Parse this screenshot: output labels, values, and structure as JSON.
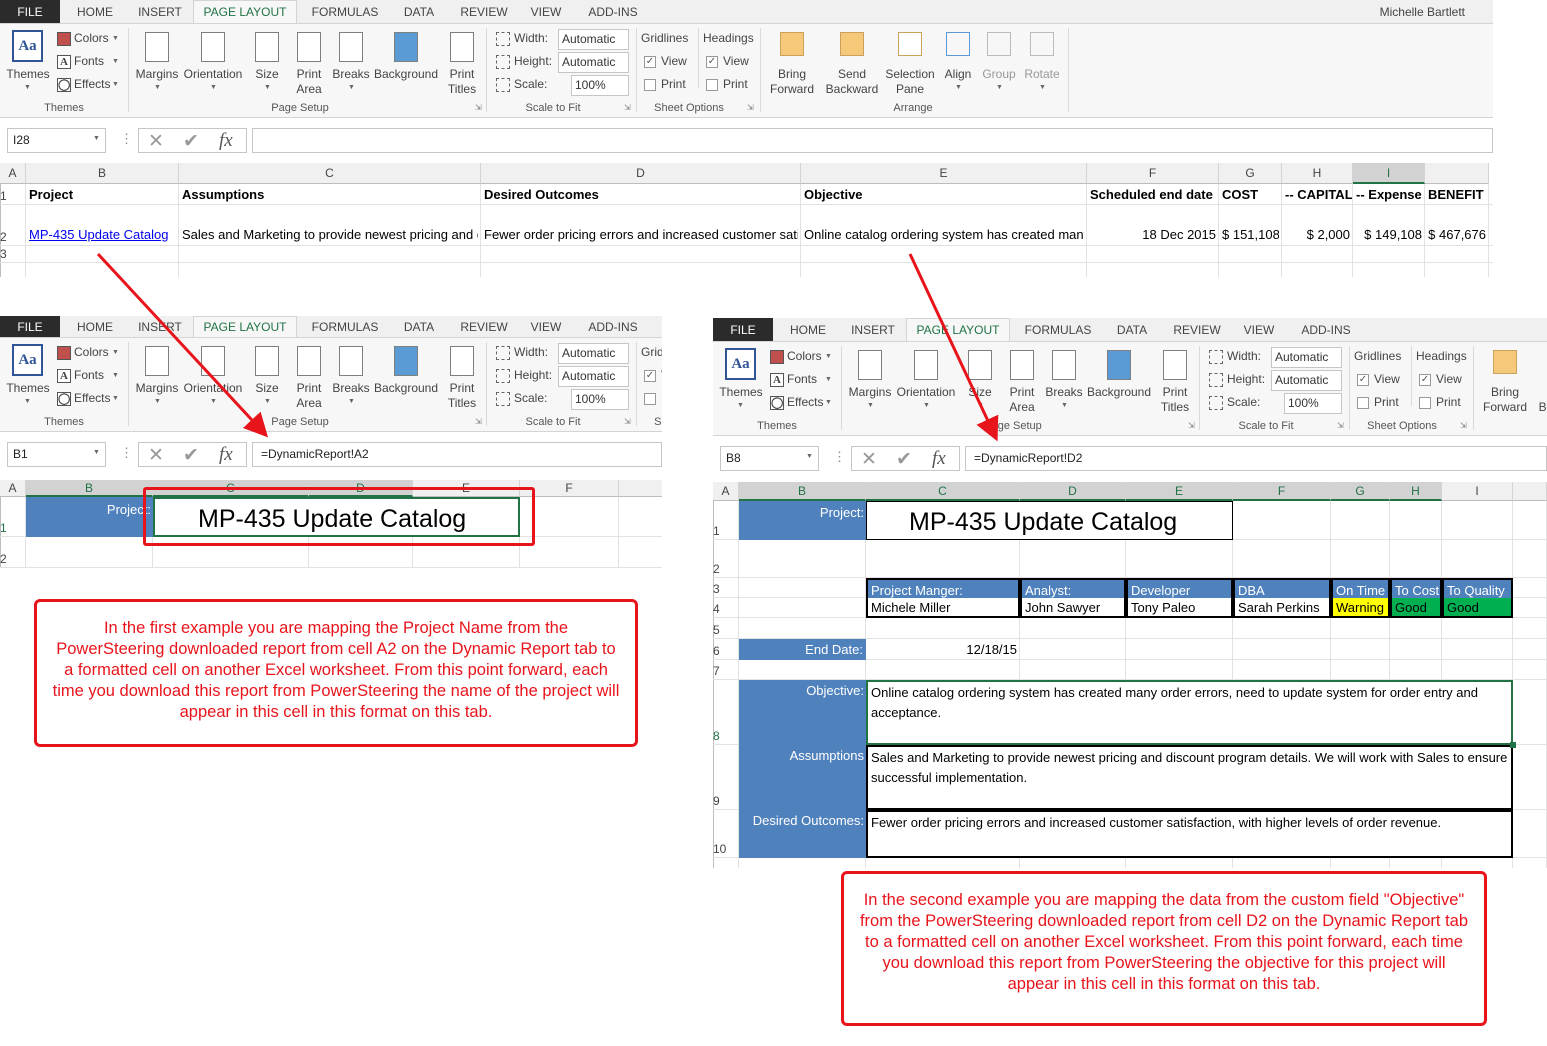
{
  "window": {
    "user": "Michelle Bartlett"
  },
  "ribbon": {
    "tabs": [
      "FILE",
      "HOME",
      "INSERT",
      "PAGE LAYOUT",
      "FORMULAS",
      "DATA",
      "REVIEW",
      "VIEW",
      "ADD-INS"
    ],
    "active_tab": "PAGE LAYOUT",
    "themes": {
      "themes": "Themes",
      "colors": "Colors",
      "fonts": "Fonts",
      "effects": "Effects",
      "group": "Themes"
    },
    "page_setup": {
      "margins": "Margins",
      "orientation": "Orientation",
      "size": "Size",
      "print_area_1": "Print",
      "print_area_2": "Area",
      "breaks": "Breaks",
      "background": "Background",
      "print_titles_1": "Print",
      "print_titles_2": "Titles",
      "group": "Page Setup"
    },
    "scale_to_fit": {
      "width_label": "Width:",
      "width_value": "Automatic",
      "height_label": "Height:",
      "height_value": "Automatic",
      "scale_label": "Scale:",
      "scale_value": "100%",
      "group": "Scale to Fit"
    },
    "sheet_options": {
      "gridlines": "Gridlines",
      "headings": "Headings",
      "view": "View",
      "print": "Print",
      "gridlines_view": true,
      "gridlines_print": false,
      "headings_view": true,
      "headings_print": false,
      "group": "Sheet Options"
    },
    "arrange": {
      "bring_1": "Bring",
      "bring_2": "Forward",
      "send_1": "Send",
      "send_2": "Backward",
      "selection_1": "Selection",
      "selection_2": "Pane",
      "align": "Align",
      "group_btn": "Group",
      "rotate": "Rotate",
      "group": "Arrange"
    }
  },
  "colors": {
    "accent": "#217346",
    "header_fill": "#4f81bd",
    "warning": "#ffff00",
    "good": "#00b050",
    "callout": "#e8141b"
  },
  "example1_source": {
    "name_box": "I28",
    "formula": "",
    "columns": [
      "A",
      "B",
      "C",
      "D",
      "E",
      "F",
      "G",
      "H",
      "I"
    ],
    "rows": [
      "1",
      "2",
      "3"
    ],
    "headers": [
      "Project",
      "Assumptions",
      "Desired Outcomes",
      "Objective",
      "Scheduled end date",
      "COST",
      "-- CAPITAL",
      "-- Expense",
      "BENEFIT"
    ],
    "values": [
      "MP-435 Update Catalog",
      "Sales and Marketing to provide newest pricing and discount program details. We will work with Sales to ensure successful implementation.",
      "Fewer order pricing errors and increased customer satisfaction, with higher levels of order revenue.",
      "Online catalog ordering system has created many order errors, need to update system for order entry and acceptance.",
      "18 Dec 2015",
      "$ 151,108",
      "$ 2,000",
      "$ 149,108",
      "$ 467,676"
    ]
  },
  "example1_target": {
    "name_box": "B1",
    "formula": "=DynamicReport!A2",
    "columns": [
      "A",
      "B",
      "C",
      "D",
      "E",
      "F"
    ],
    "rows": [
      "1",
      "2"
    ],
    "label": "Project:",
    "value": "MP-435 Update Catalog"
  },
  "example2_target": {
    "name_box": "B8",
    "formula": "=DynamicReport!D2",
    "columns": [
      "A",
      "B",
      "C",
      "D",
      "E",
      "F",
      "G",
      "H",
      "I"
    ],
    "rows": [
      "1",
      "2",
      "3",
      "4",
      "5",
      "6",
      "7",
      "8",
      "9",
      "10"
    ],
    "project_label": "Project:",
    "project_value": "MP-435 Update Catalog",
    "team_headers": [
      "Project Manger:",
      "Analyst:",
      "Developer",
      "DBA"
    ],
    "team_values": [
      "Michele Miller",
      "John Sawyer",
      "Tony Paleo",
      "Sarah Perkins"
    ],
    "status_headers": [
      "On Time",
      "To Cost",
      "To Quality"
    ],
    "status_values": [
      "Warning",
      "Good",
      "Good"
    ],
    "end_date_label": "End Date:",
    "end_date_value": "12/18/15",
    "objective_label": "Objective:",
    "objective_value": "Online catalog ordering system has created many order errors, need to update system for order entry and acceptance.",
    "assumptions_label": "Assumptions",
    "assumptions_value": "Sales and Marketing to provide newest pricing and discount program details. We will work with Sales to ensure successful implementation.",
    "outcomes_label": "Desired Outcomes:",
    "outcomes_value": "Fewer order pricing errors and increased customer satisfaction, with higher levels of order revenue."
  },
  "callouts": [
    "In the first example you are mapping the Project Name from the PowerSteering downloaded report from cell A2 on the Dynamic Report tab to a formatted cell on another Excel worksheet. From this point forward, each time you download this report from PowerSteering the name of the project will appear in this cell in this format on this tab.",
    "In the second example you are mapping the data from the custom field \"Objective\" from the PowerSteering downloaded report from cell D2 on the Dynamic Report tab to a formatted cell on another Excel worksheet. From this point forward, each time you download this report from PowerSteering the objective for this project will appear in this cell in this format on this tab."
  ]
}
